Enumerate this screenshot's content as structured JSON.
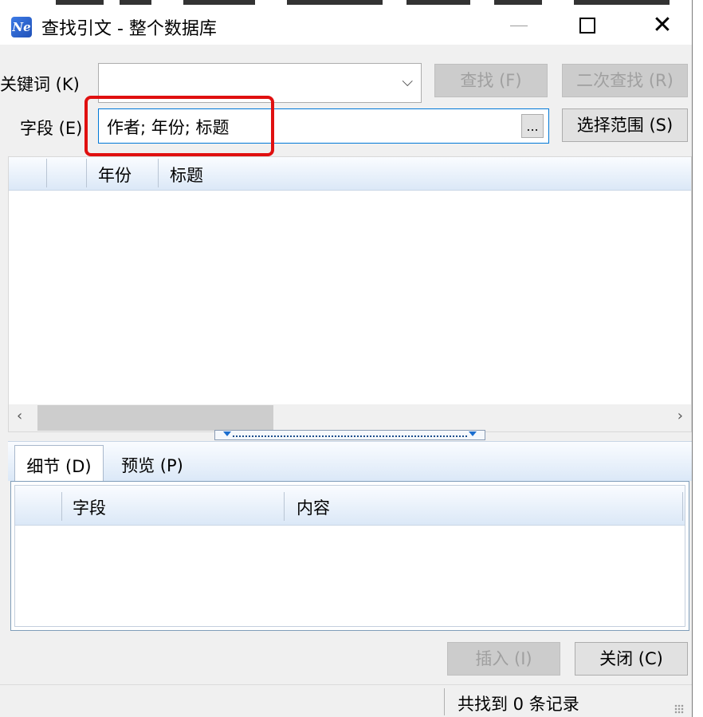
{
  "window": {
    "title": "查找引文 - 整个数据库",
    "app_icon_text": "Ne"
  },
  "search": {
    "keyword_label": "关键词 (K)",
    "keyword_value": "",
    "find_button": "查找 (F)",
    "second_find_button": "二次查找 (R)",
    "field_label": "字段 (E)",
    "field_value": "作者; 年份; 标题",
    "field_browse_button": "...",
    "select_range_button": "选择范围 (S)"
  },
  "results": {
    "columns": [
      "",
      "",
      "年份",
      "标题"
    ],
    "rows": []
  },
  "tabs": [
    {
      "label": "细节 (D)",
      "active": true
    },
    {
      "label": "预览 (P)",
      "active": false
    }
  ],
  "details": {
    "columns": [
      "",
      "字段",
      "内容"
    ],
    "rows": []
  },
  "footer": {
    "insert_button": "插入 (I)",
    "close_button": "关闭 (C)"
  },
  "status": {
    "text": "共找到 0 条记录"
  },
  "colors": {
    "highlight_box": "#e01010",
    "focus_border": "#0078d7"
  }
}
